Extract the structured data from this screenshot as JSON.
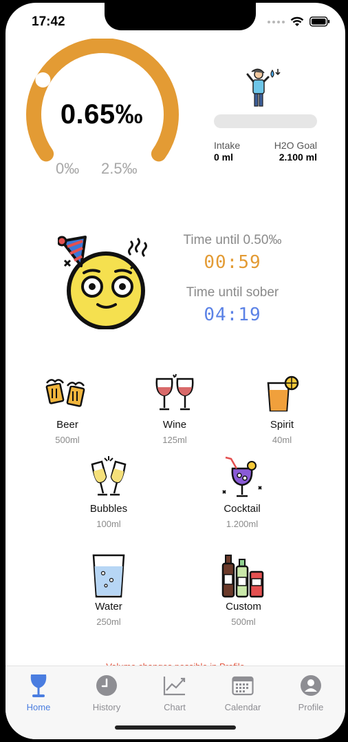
{
  "status_bar": {
    "time": "17:42"
  },
  "gauge": {
    "value_text": "0.65‰",
    "min_label": "0‰",
    "max_label": "2.5‰",
    "fill_fraction": 0.26,
    "color": "#e39b34"
  },
  "water": {
    "icon": "person-drinking-water-icon",
    "intake_label": "Intake",
    "intake_value": "0 ml",
    "goal_label": "H2O Goal",
    "goal_value": "2.100 ml",
    "progress_fraction": 0
  },
  "sober": {
    "emoji": "party-face-icon",
    "until_limit_label": "Time until 0.50‰",
    "until_limit_value": "00:59",
    "until_limit_color": "#e39b34",
    "until_sober_label": "Time until sober",
    "until_sober_value": "04:19",
    "until_sober_color": "#5b82e6"
  },
  "drinks": [
    {
      "name": "Beer",
      "volume": "500ml",
      "icon": "beer-mugs-icon"
    },
    {
      "name": "Wine",
      "volume": "125ml",
      "icon": "wine-glasses-icon"
    },
    {
      "name": "Spirit",
      "volume": "40ml",
      "icon": "spirit-glass-icon"
    },
    {
      "name": "Bubbles",
      "volume": "100ml",
      "icon": "champagne-glasses-icon"
    },
    {
      "name": "Cocktail",
      "volume": "1.200ml",
      "icon": "cocktail-icon"
    },
    {
      "name": "Water",
      "volume": "250ml",
      "icon": "water-glass-icon"
    },
    {
      "name": "Custom",
      "volume": "500ml",
      "icon": "bottles-icon"
    }
  ],
  "hint": "Volume changes possible in Profile",
  "tabs": [
    {
      "label": "Home",
      "icon": "wine-glass-icon",
      "active": true
    },
    {
      "label": "History",
      "icon": "clock-icon",
      "active": false
    },
    {
      "label": "Chart",
      "icon": "line-chart-icon",
      "active": false
    },
    {
      "label": "Calendar",
      "icon": "calendar-icon",
      "active": false
    },
    {
      "label": "Profile",
      "icon": "person-icon",
      "active": false
    }
  ],
  "colors": {
    "accent": "#4a7de0",
    "gauge": "#e39b34",
    "tab_inactive": "#8e8e93"
  }
}
